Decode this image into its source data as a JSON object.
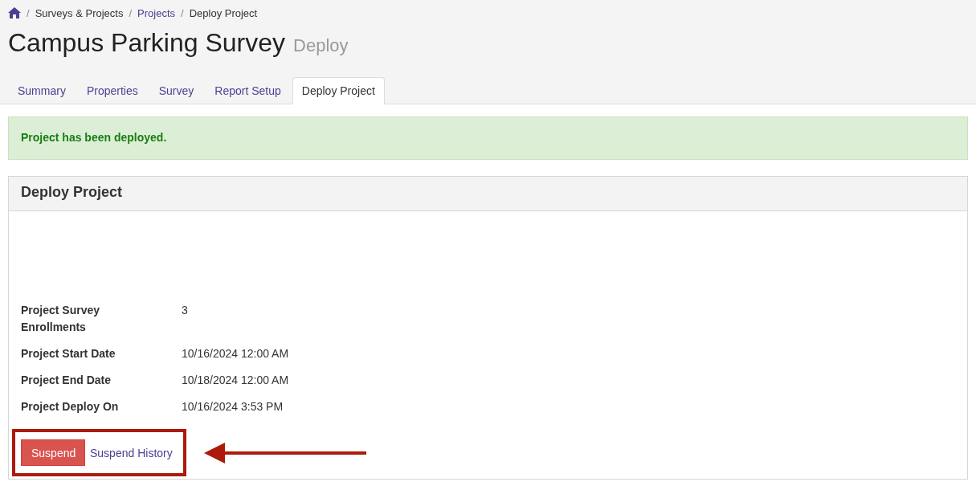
{
  "breadcrumb": [
    {
      "kind": "home"
    },
    {
      "kind": "separator",
      "label": "/"
    },
    {
      "kind": "text",
      "label": "Surveys & Projects"
    },
    {
      "kind": "separator",
      "label": "/"
    },
    {
      "kind": "link",
      "label": "Projects"
    },
    {
      "kind": "separator",
      "label": "/"
    },
    {
      "kind": "text",
      "label": "Deploy Project"
    }
  ],
  "page_title": {
    "title": "Campus Parking Survey",
    "subtitle": "Deploy"
  },
  "tabs": [
    {
      "label": "Summary",
      "selected": false
    },
    {
      "label": "Properties",
      "selected": false
    },
    {
      "label": "Survey",
      "selected": false
    },
    {
      "label": "Report Setup",
      "selected": false
    },
    {
      "label": "Deploy Project",
      "selected": true
    }
  ],
  "alert": {
    "kind": "success",
    "message": "Project has been deployed."
  },
  "panel": {
    "title": "Deploy Project",
    "details": [
      {
        "label": "Project Survey Enrollments",
        "value": "3"
      },
      {
        "label": "Project Start Date",
        "value": "10/16/2024 12:00 AM"
      },
      {
        "label": "Project End Date",
        "value": "10/18/2024 12:00 AM"
      },
      {
        "label": "Project Deploy On",
        "value": "10/16/2024 3:53 PM"
      }
    ],
    "actions": [
      {
        "kind": "danger_button",
        "label": "Suspend"
      },
      {
        "kind": "link",
        "label": "Suspend History"
      }
    ],
    "actions_highlighted": true
  }
}
